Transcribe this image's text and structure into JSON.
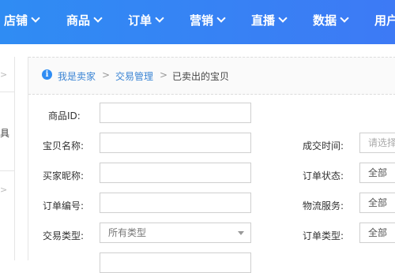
{
  "topnav": {
    "items": [
      {
        "label": "店铺"
      },
      {
        "label": "商品"
      },
      {
        "label": "订单"
      },
      {
        "label": "营销"
      },
      {
        "label": "直播"
      },
      {
        "label": "数据"
      },
      {
        "label": "用户"
      }
    ]
  },
  "sidebar": {
    "partial_text": "具"
  },
  "breadcrumb": {
    "items": [
      "我是卖家",
      "交易管理",
      "已卖出的宝贝"
    ],
    "separator": ">"
  },
  "form": {
    "product_id": {
      "label": "商品ID:",
      "value": ""
    },
    "item_name": {
      "label": "宝贝名称:",
      "value": ""
    },
    "buyer_nick": {
      "label": "买家昵称:",
      "value": ""
    },
    "order_no": {
      "label": "订单编号:",
      "value": ""
    },
    "trade_type": {
      "label": "交易类型:",
      "value": "所有类型"
    },
    "deal_time": {
      "label": "成交时间:",
      "placeholder": "请选择时间"
    },
    "order_status": {
      "label": "订单状态:",
      "value": "全部"
    },
    "logistics": {
      "label": "物流服务:",
      "value": "全部"
    },
    "order_type": {
      "label": "订单类型:",
      "value": "全部"
    }
  },
  "colors": {
    "nav_start": "#2f8cf3",
    "nav_end": "#3d7af5",
    "link": "#3a84d4",
    "border": "#cfcfcf"
  }
}
